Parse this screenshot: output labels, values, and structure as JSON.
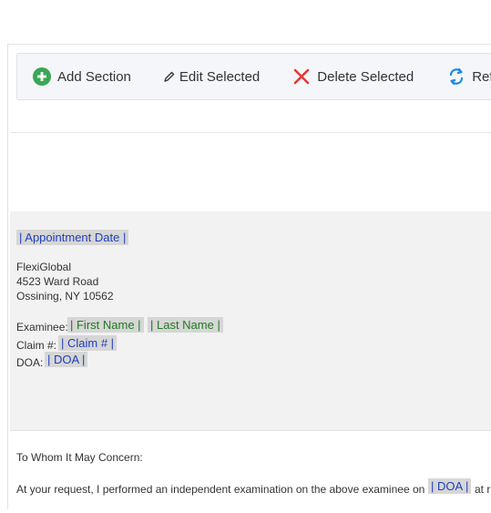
{
  "toolbar": {
    "add_label": "Add Section",
    "edit_label": "Edit Selected",
    "delete_label": "Delete Selected",
    "refresh_label": "Refr"
  },
  "letter": {
    "appointment_date_field": "| Appointment Date |",
    "address": {
      "line1": "FlexiGlobal",
      "line2": "4523  Ward Road",
      "line3": "Ossining, NY 10562"
    },
    "examinee_label": "Examinee:",
    "first_name_field": "| First Name |",
    "last_name_field": "| Last Name |",
    "claim_label": "Claim #:",
    "claim_field": "| Claim # |",
    "doa_label": "DOA:",
    "doa_field": "| DOA |",
    "salutation": "To Whom It May Concern:",
    "body_text": "At your request, I performed an independent examination on the above examinee on",
    "body_doa_field": "| DOA |",
    "body_trailing": "at r"
  },
  "colors": {
    "add_icon": "#3aa657",
    "delete_icon": "#e53935",
    "refresh_icon": "#1e88e5",
    "merge_field_blue": "#1f3fbf",
    "merge_field_green": "#1f7a1f",
    "merge_field_bg": "#d6d6d6",
    "section_bg": "#f2f2f2"
  }
}
